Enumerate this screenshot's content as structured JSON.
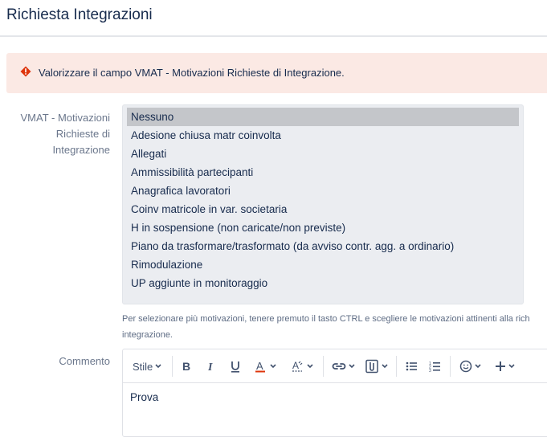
{
  "page": {
    "title": "Richiesta Integrazioni"
  },
  "error": {
    "message": "Valorizzare il campo VMAT - Motivazioni Richieste di Integrazione.",
    "icon": "error-icon",
    "color": "#de350b"
  },
  "vmat": {
    "label_line1": "VMAT - Motivazioni",
    "label_line2": "Richieste di",
    "label_line3": "Integrazione",
    "options": [
      "Nessuno",
      "Adesione chiusa matr coinvolta",
      "Allegati",
      "Ammissibilità partecipanti",
      "Anagrafica lavoratori",
      "Coinv matricole in var. societaria",
      "H in sospensione (non caricate/non previste)",
      "Piano da trasformare/trasformato (da avviso contr. agg. a ordinario)",
      "Rimodulazione",
      "UP aggiunte in monitoraggio"
    ],
    "selected": "Nessuno",
    "help_line1": "Per selezionare più motivazioni, tenere premuto il tasto CTRL e scegliere le motivazioni attinenti alla rich",
    "help_line2": "integrazione."
  },
  "comment": {
    "label": "Commento",
    "value": "Prova",
    "toolbar": {
      "style_label": "Stile",
      "icons": [
        "bold-icon",
        "italic-icon",
        "underline-icon",
        "text-color-icon",
        "clear-format-icon",
        "link-icon",
        "attachment-icon",
        "bullet-list-icon",
        "numbered-list-icon",
        "emoji-icon",
        "insert-more-icon"
      ],
      "text_color": "#de350b"
    }
  }
}
